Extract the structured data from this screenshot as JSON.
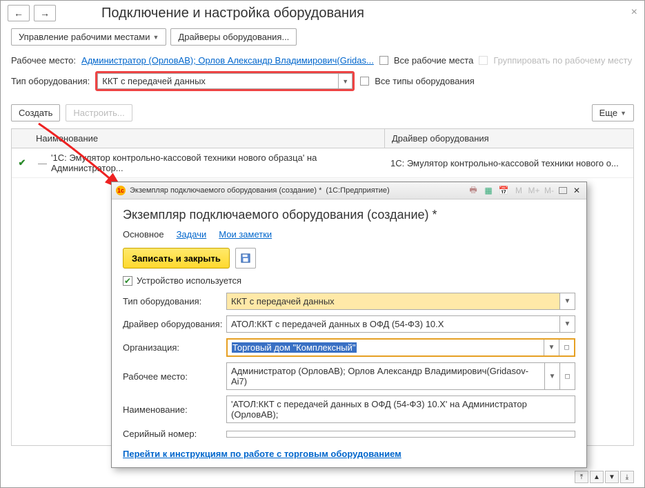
{
  "header": {
    "title": "Подключение и настройка оборудования"
  },
  "toolbar": {
    "mgmt_label": "Управление рабочими местами",
    "drivers_label": "Драйверы оборудования..."
  },
  "row1": {
    "label": "Рабочее место:",
    "link": "Администратор (ОрловАВ); Орлов Александр Владимирович(Gridas...",
    "chk1": "Все рабочие места",
    "chk2": "Группировать по рабочему месту"
  },
  "row2": {
    "label": "Тип оборудования:",
    "value": "ККТ с передачей данных",
    "chk": "Все типы оборудования"
  },
  "actions": {
    "create": "Создать",
    "configure": "Настроить...",
    "more": "Еще"
  },
  "table": {
    "col1": "Наименование",
    "col2": "Драйвер оборудования",
    "row1_name": "'1С: Эмулятор контрольно-кассовой техники нового образца' на Администратор...",
    "row1_drv": "1С: Эмулятор контрольно-кассовой техники нового о..."
  },
  "dialog": {
    "wintitle_left": "Экземпляр подключаемого оборудования (создание) *",
    "wintitle_right": "(1С:Предприятие)",
    "heading": "Экземпляр подключаемого оборудования (создание) *",
    "tabs": {
      "main": "Основное",
      "tasks": "Задачи",
      "notes": "Мои заметки"
    },
    "save": "Записать и закрыть",
    "device_used": "Устройство используется",
    "f_type_l": "Тип оборудования:",
    "f_type_v": "ККТ с передачей данных",
    "f_drv_l": "Драйвер оборудования:",
    "f_drv_v": "АТОЛ:ККТ с передачей данных в ОФД (54-ФЗ) 10.X",
    "f_org_l": "Организация:",
    "f_org_v": "Торговый дом \"Комплексный\"",
    "f_wp_l": "Рабочее место:",
    "f_wp_v": "Администратор (ОрловАВ); Орлов Александр Владимирович(Gridasov-Ai7)",
    "f_name_l": "Наименование:",
    "f_name_v": "'АТОЛ:ККТ с передачей данных в ОФД (54-ФЗ) 10.X' на Администратор (ОрловАВ);",
    "f_sn_l": "Серийный номер:",
    "f_sn_v": "",
    "link": "Перейти к инструкциям по работе с торговым оборудованием",
    "m_labels": {
      "m": "M",
      "mp": "M+",
      "mm": "M-"
    }
  }
}
